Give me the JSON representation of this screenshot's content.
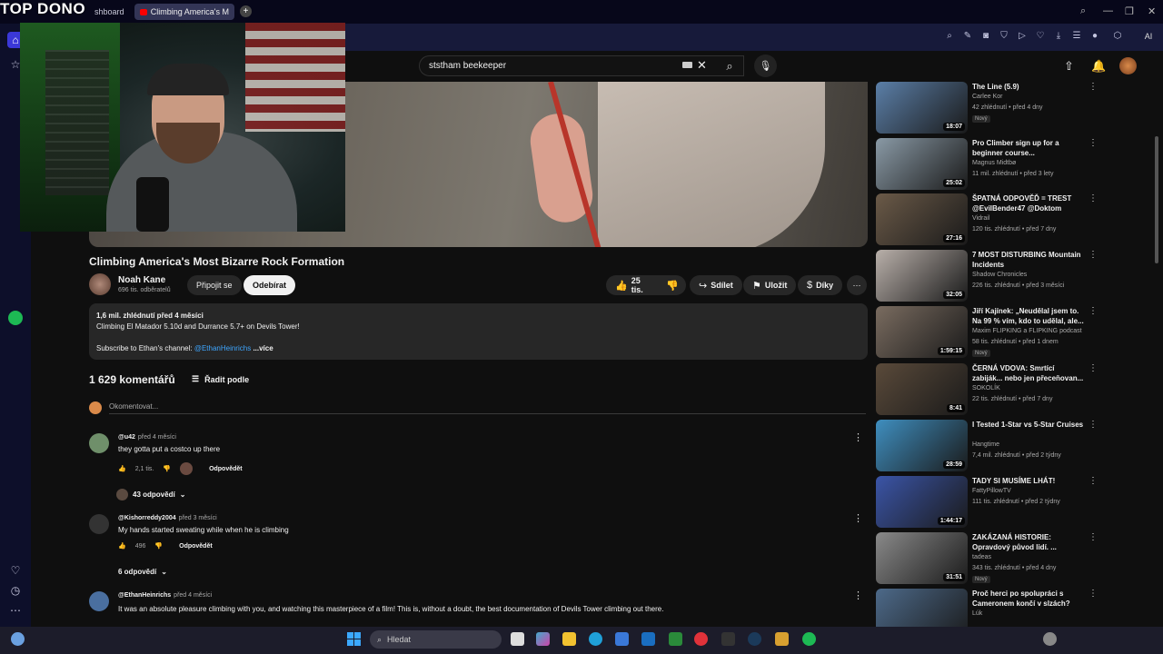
{
  "stream": {
    "logo": "TOP DONO"
  },
  "browser": {
    "tabs": [
      {
        "label": "shboard"
      },
      {
        "label": "Climbing America's M"
      }
    ],
    "new_tab": "+",
    "ai_label": "AI"
  },
  "youtube": {
    "search": {
      "value": "ststham beekeeper"
    },
    "video": {
      "title": "Climbing America's Most Bizarre Rock Formation",
      "channel": "Noah Kane",
      "subscribers": "696 tis. odběratelů",
      "join_label": "Připojit se",
      "subscribe_label": "Odebírat",
      "likes": "25 tis.",
      "share_label": "Sdílet",
      "save_label": "Uložit",
      "thanks_label": "Díky"
    },
    "description": {
      "meta": "1,6 mil. zhlédnutí  před 4 měsíci",
      "line1": "Climbing El Matador 5.10d and Durrance 5.7+ on Devils Tower!",
      "line2_prefix": "Subscribe to Ethan's channel: ",
      "line2_link": "@EthanHeinrichs",
      "more": "...více"
    },
    "comments": {
      "count": "1 629 komentářů",
      "sort_label": "Řadit podle",
      "placeholder": "Okomentovat...",
      "items": [
        {
          "author": "@u42",
          "time": "před 4 měsíci",
          "text": "they gotta put a costco up there",
          "likes": "2,1 tis.",
          "reply": "Odpovědět",
          "replies": "43 odpovědí",
          "avatar_color": "#6f8f6a"
        },
        {
          "author": "@Kishorreddy2004",
          "time": "před 3 měsíci",
          "text": "My hands started sweating while when he is climbing",
          "likes": "496",
          "reply": "Odpovědět",
          "replies": "6 odpovědí",
          "avatar_color": "#333333"
        },
        {
          "author": "@EthanHeinrichs",
          "time": "před 4 měsíci",
          "text": "It was an absolute pleasure climbing with you, and watching this masterpiece of a film! This is, without a doubt, the best documentation of Devils Tower climbing out there.",
          "avatar_color": "#4a6f9f"
        }
      ]
    },
    "recommendations": [
      {
        "title": "The Line (5.9)",
        "channel": "Carlee Kor",
        "meta": "42 zhlédnutí • před 4 dny",
        "badge": "Nový",
        "duration": "18:07",
        "color": "#5b7fa8"
      },
      {
        "title": "Pro Climber sign up for a beginner course...",
        "channel": "Magnus Midtbø",
        "meta": "11 mil. zhlédnutí • před 3 lety",
        "duration": "25:02",
        "color": "#8a9aa6"
      },
      {
        "title": "ŠPATNÁ ODPOVĚĎ = TREST @EvilBender47 @Doktom",
        "channel": "Vidrail",
        "meta": "120 tis. zhlédnutí • před 7 dny",
        "duration": "27:16",
        "color": "#6b5a48"
      },
      {
        "title": "7 MOST DISTURBING Mountain Incidents",
        "channel": "Shadow Chronicles",
        "meta": "226 tis. zhlédnutí • před 3 měsíci",
        "duration": "32:05",
        "color": "#b9b0aa"
      },
      {
        "title": "Jiří Kajínek: „Neudělal jsem to. Na 99 % vím, kdo to udělal, ale...",
        "channel": "Maxim FLIPKING a FLIPKING podcast",
        "meta": "58 tis. zhlédnutí • před 1 dnem",
        "badge": "Nový",
        "duration": "1:59:15",
        "color": "#7a6c60"
      },
      {
        "title": "ČERNÁ VDOVA: Smrtící zabiják... nebo jen přeceňovan...",
        "channel": "SOKOLÍK",
        "meta": "22 tis. zhlédnutí • před 7 dny",
        "duration": "8:41",
        "color": "#5a4a3a"
      },
      {
        "title": "I Tested 1-Star vs 5-Star Cruises",
        "channel": "Hangtime",
        "meta": "7,4 mil. zhlédnutí • před 2 týdny",
        "duration": "28:59",
        "color": "#3f8fc0"
      },
      {
        "title": "TADY SI MUSÍME LHÁT!",
        "channel": "FattyPillowTV",
        "meta": "111 tis. zhlédnutí • před 2 týdny",
        "duration": "1:44:17",
        "color": "#3b55a8"
      },
      {
        "title": "ZAKÁZANÁ HISTORIE: Opravdový původ lidí. ...",
        "channel": "tadeas",
        "meta": "343 tis. zhlédnutí • před 4 dny",
        "badge": "Nový",
        "duration": "31:51",
        "color": "#8a8a8a"
      },
      {
        "title": "Proč herci po spolupráci s Cameronem končí v slzách?",
        "channel": "Lúk",
        "meta": "",
        "duration": "",
        "color": "#4d6a8a"
      }
    ]
  },
  "taskbar": {
    "search_placeholder": "Hledat"
  }
}
